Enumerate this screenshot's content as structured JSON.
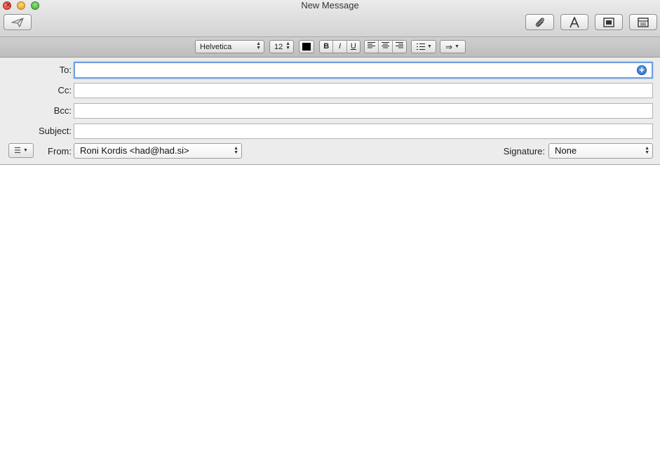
{
  "window": {
    "title": "New Message"
  },
  "toolbar": {
    "send_icon": "paper-plane-icon",
    "attach_icon": "paperclip-icon",
    "fonts_icon": "font-a-icon",
    "photo_icon": "photo-browser-icon",
    "template_icon": "stationery-icon"
  },
  "format_bar": {
    "font_family": "Helvetica",
    "font_size": "12",
    "text_color": "#000000",
    "bold": "B",
    "italic": "I",
    "underline": "U"
  },
  "fields": {
    "to_label": "To:",
    "cc_label": "Cc:",
    "bcc_label": "Bcc:",
    "subject_label": "Subject:",
    "to_value": "",
    "cc_value": "",
    "bcc_value": "",
    "subject_value": ""
  },
  "from": {
    "label": "From:",
    "value": "Roni Kordis <had@had.si>"
  },
  "signature": {
    "label": "Signature:",
    "value": "None"
  },
  "colors": {
    "focus_ring": "#6f9ede",
    "accent": "#2a66c7"
  }
}
